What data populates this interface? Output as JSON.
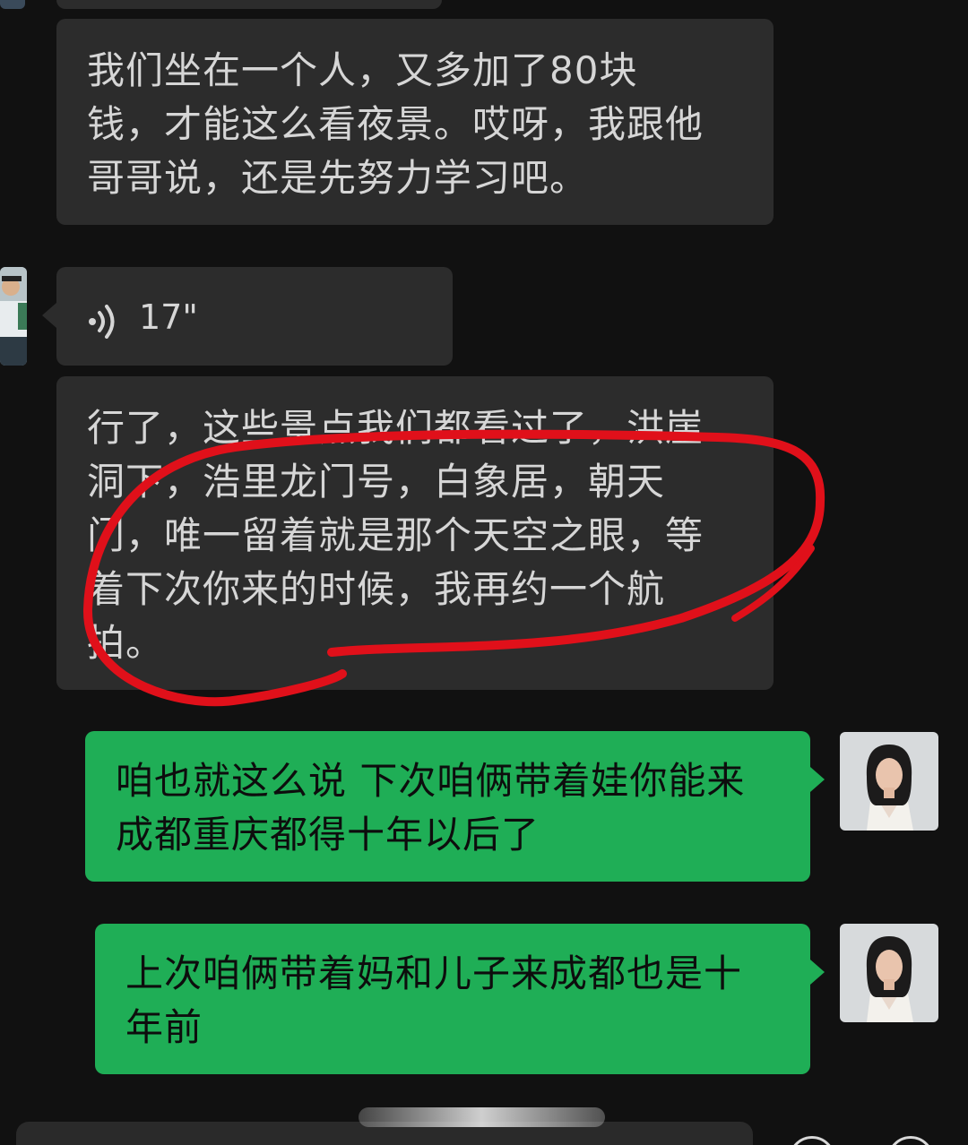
{
  "messages": [
    {
      "side": "incoming",
      "type": "text",
      "lines": [
        "我们坐在一个人，又多加了80块",
        "钱，才能这么看夜景。哎呀，我跟他",
        "哥哥说，还是先努力学习吧。"
      ]
    },
    {
      "side": "incoming",
      "type": "voice",
      "duration": "17\""
    },
    {
      "side": "incoming",
      "type": "text",
      "lines": [
        "行了，这些景点我们都看过了，洪崖",
        "洞下，浩里龙门号，白象居，朝天",
        "门，唯一留着就是那个天空之眼，等",
        "着下次你来的时候，我再约一个航",
        "拍。"
      ]
    },
    {
      "side": "outgoing",
      "type": "text",
      "lines": [
        "咱也就这么说 下次咱俩带着娃你能来",
        "成都重庆都得十年以后了"
      ]
    },
    {
      "side": "outgoing",
      "type": "text",
      "lines": [
        "上次咱俩带着妈和儿子来成都也是十",
        "年前"
      ]
    }
  ],
  "annotation": {
    "shape": "hand-drawn ellipse",
    "color": "#e0101a",
    "highlights": "third message"
  },
  "icons": {
    "voice": "voice-wave-icon",
    "input_left": "circle-button",
    "input_right": "circle-button"
  },
  "colors": {
    "background": "#111111",
    "incoming_bubble": "#2c2c2c",
    "outgoing_bubble": "#1fae56",
    "incoming_text": "#d6d6d6",
    "outgoing_text": "#0d0d0d"
  }
}
